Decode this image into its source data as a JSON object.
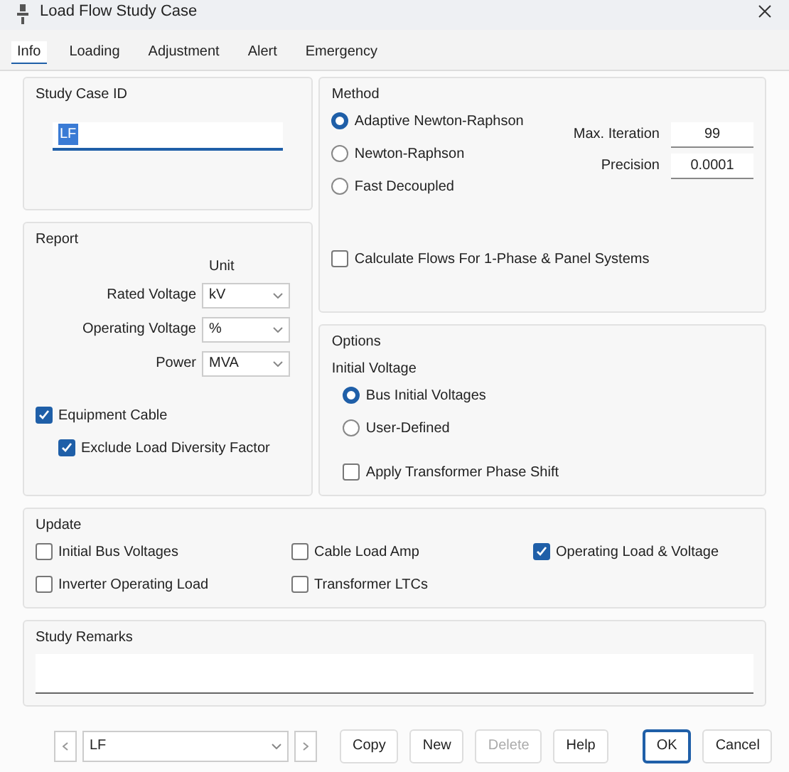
{
  "window": {
    "title": "Load Flow Study Case"
  },
  "tabs": [
    {
      "label": "Info",
      "selected": true
    },
    {
      "label": "Loading",
      "selected": false
    },
    {
      "label": "Adjustment",
      "selected": false
    },
    {
      "label": "Alert",
      "selected": false
    },
    {
      "label": "Emergency",
      "selected": false
    }
  ],
  "study_case_id": {
    "label": "Study Case ID",
    "value": "LF"
  },
  "report": {
    "label": "Report",
    "unit_label": "Unit",
    "fields": [
      {
        "label": "Rated Voltage",
        "value": "kV"
      },
      {
        "label": "Operating Voltage",
        "value": "%"
      },
      {
        "label": "Power",
        "value": "MVA"
      }
    ],
    "checkboxes": [
      {
        "label": "Equipment Cable",
        "checked": true,
        "children": [
          {
            "label": "Exclude Load Diversity Factor",
            "checked": true
          }
        ]
      }
    ]
  },
  "method": {
    "label": "Method",
    "options": [
      {
        "label": "Adaptive Newton-Raphson",
        "selected": true
      },
      {
        "label": "Newton-Raphson",
        "selected": false
      },
      {
        "label": "Fast Decoupled",
        "selected": false
      }
    ],
    "max_iteration": {
      "label": "Max. Iteration",
      "value": "99"
    },
    "precision": {
      "label": "Precision",
      "value": "0.0001"
    },
    "checkbox": {
      "label": "Calculate Flows For 1-Phase & Panel Systems",
      "checked": false
    }
  },
  "options": {
    "label": "Options",
    "initial_voltage_label": "Initial Voltage",
    "options": [
      {
        "label": "Bus Initial Voltages",
        "selected": true
      },
      {
        "label": "User-Defined",
        "selected": false
      }
    ],
    "checkbox": {
      "label": "Apply Transformer Phase Shift",
      "checked": false
    }
  },
  "update": {
    "label": "Update",
    "checkboxes": [
      {
        "label": "Initial Bus Voltages",
        "checked": false
      },
      {
        "label": "Cable Load Amp",
        "checked": false
      },
      {
        "label": "Operating Load & Voltage",
        "checked": true
      },
      {
        "label": "Inverter Operating Load",
        "checked": false
      },
      {
        "label": "Transformer LTCs",
        "checked": false
      }
    ]
  },
  "study_remarks": {
    "label": "Study Remarks"
  },
  "footer": {
    "selector_value": "LF",
    "buttons": [
      {
        "label": "Copy",
        "disabled": false,
        "default": false
      },
      {
        "label": "New",
        "disabled": false,
        "default": false
      },
      {
        "label": "Delete",
        "disabled": true,
        "default": false
      },
      {
        "label": "Help",
        "disabled": false,
        "default": false
      },
      {
        "label": "OK",
        "disabled": false,
        "default": true
      },
      {
        "label": "Cancel",
        "disabled": false,
        "default": false
      }
    ]
  }
}
